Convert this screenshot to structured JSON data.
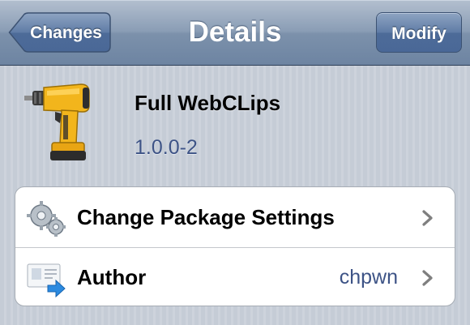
{
  "navbar": {
    "title": "Details",
    "back_label": "Changes",
    "right_label": "Modify"
  },
  "package": {
    "name": "Full WebCLips",
    "version": "1.0.0-2",
    "icon": "drill-icon"
  },
  "rows": [
    {
      "label": "Change Package Settings",
      "value": "",
      "icon": "gears-icon"
    },
    {
      "label": "Author",
      "value": "chpwn",
      "icon": "contact-card-icon"
    }
  ],
  "colors": {
    "navbar": "#7c91ab",
    "button": "#4d6b98",
    "value_text": "#3d5386",
    "background": "#c7ced8"
  }
}
